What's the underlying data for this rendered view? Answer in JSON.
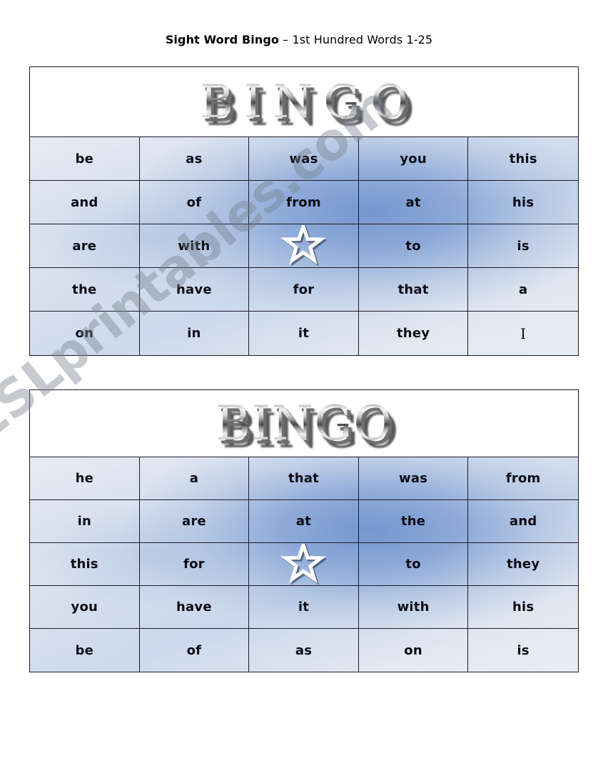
{
  "document": {
    "title_strong": "Sight Word Bingo",
    "title_rest": " – 1st Hundred Words 1-25"
  },
  "watermark": {
    "text": "ESLprintables.com",
    "color": "#78808c"
  },
  "theme": {
    "grid_line": "#1c1c2b",
    "cell_light": "#e4e9f2",
    "cell_blue": "#6c91cd",
    "text": "#0b0b14",
    "bingo_chrome_light": "#f2f2f2",
    "bingo_chrome_dark": "#3a3a3a",
    "star_outline": "#ffffff",
    "star_fill": "#6e95cf"
  },
  "cards": [
    {
      "id": "card-1",
      "heading": "BINGO",
      "heading_letters": [
        "B",
        "I",
        "N",
        "G",
        "O"
      ],
      "free_space": {
        "row": 2,
        "col": 2,
        "icon": "star-icon",
        "label": "free-space"
      },
      "rows": [
        [
          "be",
          "as",
          "was",
          "you",
          "this"
        ],
        [
          "and",
          "of",
          "from",
          "at",
          "his"
        ],
        [
          "are",
          "with",
          "",
          "to",
          "is"
        ],
        [
          "the",
          "have",
          "for",
          "that",
          "a"
        ],
        [
          "on",
          "in",
          "it",
          "they",
          "I"
        ]
      ]
    },
    {
      "id": "card-2",
      "heading": "BINGO",
      "heading_letters": [
        "B",
        "I",
        "N",
        "G",
        "O"
      ],
      "free_space": {
        "row": 2,
        "col": 2,
        "icon": "star-icon",
        "label": "free-space"
      },
      "rows": [
        [
          "he",
          "a",
          "that",
          "was",
          "from"
        ],
        [
          "in",
          "are",
          "at",
          "the",
          "and"
        ],
        [
          "this",
          "for",
          "",
          "to",
          "they"
        ],
        [
          "you",
          "have",
          "it",
          "with",
          "his"
        ],
        [
          "be",
          "of",
          "as",
          "on",
          "is"
        ]
      ]
    }
  ]
}
